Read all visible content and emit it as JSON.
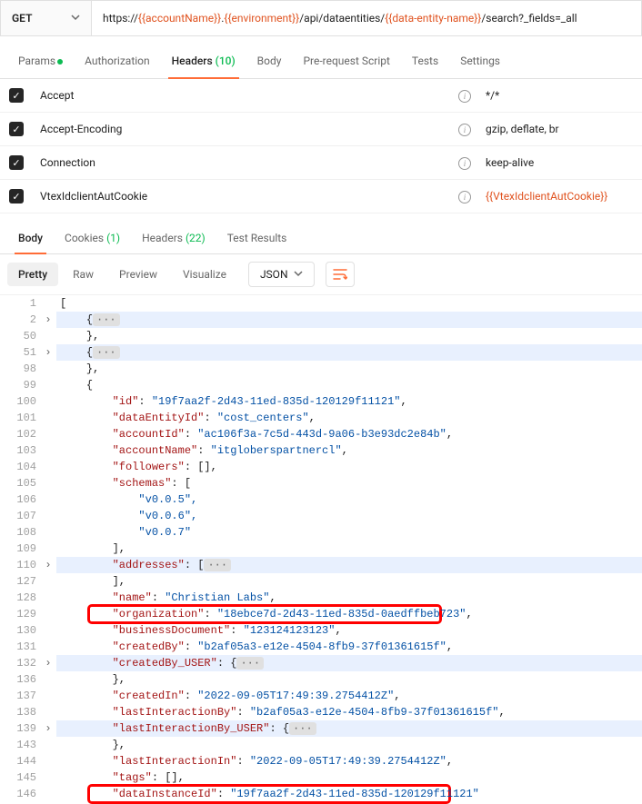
{
  "method": "GET",
  "url": {
    "p1": "https://",
    "v1": "{{accountName}}",
    "p2": ".",
    "v2": "{{environment}}",
    "p3": "/api/dataentities/",
    "v3": "{{data-entity-name}}",
    "p4": "/search?_fields=_all"
  },
  "reqTabs": {
    "params": "Params",
    "auth": "Authorization",
    "headers": "Headers",
    "headersCount": "(10)",
    "body": "Body",
    "prereq": "Pre-request Script",
    "tests": "Tests",
    "settings": "Settings"
  },
  "headers": [
    {
      "key": "Accept",
      "value": "*/*",
      "isVar": false
    },
    {
      "key": "Accept-Encoding",
      "value": "gzip, deflate, br",
      "isVar": false
    },
    {
      "key": "Connection",
      "value": "keep-alive",
      "isVar": false
    },
    {
      "key": "VtexIdclientAutCookie",
      "value": "{{VtexIdclientAutCookie}}",
      "isVar": true
    }
  ],
  "respTabs": {
    "body": "Body",
    "cookies": "Cookies",
    "cookiesCount": "(1)",
    "headers": "Headers",
    "headersCount": "(22)",
    "testResults": "Test Results"
  },
  "viewTabs": {
    "pretty": "Pretty",
    "raw": "Raw",
    "preview": "Preview",
    "visualize": "Visualize",
    "format": "JSON"
  },
  "code": {
    "l1": "[",
    "l2a": "    {",
    "l50": "    },",
    "l51a": "    {",
    "l98": "    },",
    "l99": "    {",
    "l100k": "        \"id\"",
    "l100v": "\"19f7aa2f-2d43-11ed-835d-120129f11121\"",
    "l101k": "        \"dataEntityId\"",
    "l101v": "\"cost_centers\"",
    "l102k": "        \"accountId\"",
    "l102v": "\"ac106f3a-7c5d-443d-9a06-b3e93dc2e84b\"",
    "l103k": "        \"accountName\"",
    "l103v": "\"itgloberspartnercl\"",
    "l104k": "        \"followers\"",
    "l104v": "[]",
    "l105k": "        \"schemas\"",
    "l105v": "[",
    "l106": "            \"v0.0.5\",",
    "l107": "            \"v0.0.6\",",
    "l108": "            \"v0.0.7\"",
    "l109": "        ],",
    "l110k": "        \"addresses\"",
    "l110v": "[",
    "l127": "        ],",
    "l128k": "        \"name\"",
    "l128v": "\"Christian Labs\"",
    "l129k": "        \"organization\"",
    "l129v": "\"18ebce7d-2d43-11ed-835d-0aedffbeb723\"",
    "l130k": "        \"businessDocument\"",
    "l130v": "\"123124123123\"",
    "l131k": "        \"createdBy\"",
    "l131v": "\"b2af05a3-e12e-4504-8fb9-37f01361615f\"",
    "l132k": "        \"createdBy_USER\"",
    "l132v": "{",
    "l136": "        },",
    "l137k": "        \"createdIn\"",
    "l137v": "\"2022-09-05T17:49:39.2754412Z\"",
    "l138k": "        \"lastInteractionBy\"",
    "l138v": "\"b2af05a3-e12e-4504-8fb9-37f01361615f\"",
    "l139k": "        \"lastInteractionBy_USER\"",
    "l139v": "{",
    "l143": "        },",
    "l144k": "        \"lastInteractionIn\"",
    "l144v": "\"2022-09-05T17:49:39.2754412Z\"",
    "l145k": "        \"tags\"",
    "l145v": "[]",
    "l146k": "        \"dataInstanceId\"",
    "l146v": "\"19f7aa2f-2d43-11ed-835d-120129f11121\""
  },
  "chart_data": null
}
